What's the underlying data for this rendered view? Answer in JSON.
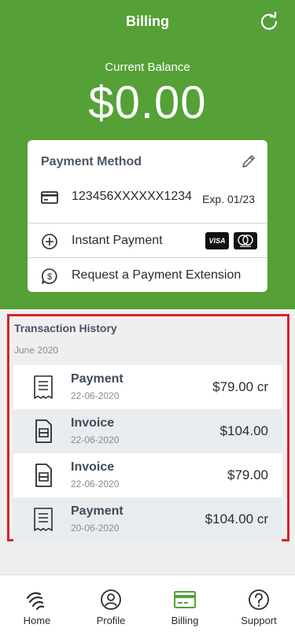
{
  "header": {
    "title": "Billing",
    "balance_label": "Current Balance",
    "balance_value": "$0.00"
  },
  "payment_method": {
    "title": "Payment Method",
    "card_number": "123456XXXXXX1234",
    "expiry": "Exp. 01/23",
    "instant_label": "Instant Payment",
    "visa_label": "VISA",
    "extension_label": "Request a Payment Extension"
  },
  "transactions": {
    "title": "Transaction History",
    "month": "June 2020",
    "items": [
      {
        "type": "Payment",
        "date": "22-06-2020",
        "amount": "$79.00 cr"
      },
      {
        "type": "Invoice",
        "date": "22-06-2020",
        "amount": "$104.00"
      },
      {
        "type": "Invoice",
        "date": "22-06-2020",
        "amount": "$79.00"
      },
      {
        "type": "Payment",
        "date": "20-06-2020",
        "amount": "$104.00 cr"
      }
    ]
  },
  "nav": {
    "items": [
      {
        "label": "Home",
        "icon": "home-icon"
      },
      {
        "label": "Profile",
        "icon": "profile-icon"
      },
      {
        "label": "Billing",
        "icon": "billing-icon"
      },
      {
        "label": "Support",
        "icon": "support-icon"
      }
    ],
    "active": "Billing"
  },
  "colors": {
    "brand_green": "#55a037",
    "highlight_red": "#d8232a"
  }
}
